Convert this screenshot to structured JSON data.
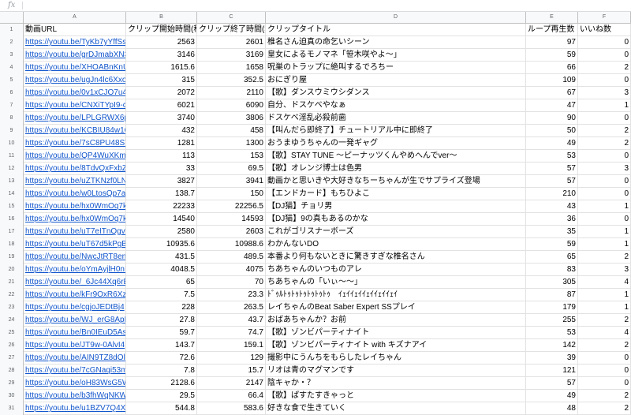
{
  "formula_bar": {
    "fx_label": "fx",
    "value": ""
  },
  "columns": [
    "A",
    "B",
    "C",
    "D",
    "E",
    "F"
  ],
  "header_row": [
    "動画URL",
    "クリップ開始時間(秒)",
    "クリップ終了時間(秒)",
    "クリップタイトル",
    "ループ再生数",
    "いいね数"
  ],
  "rows": [
    [
      "https://youtu.be/TyKb7yYffSs",
      "2563",
      "2601",
      "椎名さん迫真の命乞いシーン",
      "97",
      "0"
    ],
    [
      "https://youtu.be/grDJmabXN3o",
      "3146",
      "3169",
      "皇女によるモノマネ「笹木咲やよ〜」",
      "59",
      "0"
    ],
    [
      "https://youtu.be/XHOABnKnU1s",
      "1615.6",
      "1658",
      "呪巣のトラップに絶叫するでろちー",
      "66",
      "2"
    ],
    [
      "https://youtu.be/ugJn4lc6Xxo",
      "315",
      "352.5",
      "おにぎり屋",
      "109",
      "0"
    ],
    [
      "https://youtu.be/0v1xCJO7u4E",
      "2072",
      "2110",
      "【歌】ダンスウミウシダンス",
      "67",
      "3"
    ],
    [
      "https://youtu.be/CNXiTYpI9-c",
      "6021",
      "6090",
      "自分、ドスケベやなぁ",
      "47",
      "1"
    ],
    [
      "https://youtu.be/LPLGRWX6pm0",
      "3740",
      "3806",
      "ドスケベ淫乱必殺前歯",
      "90",
      "0"
    ],
    [
      "https://youtu.be/KCBIU84w1Q0",
      "432",
      "458",
      "【叫んだら即終了】チュートリアル中に即終了",
      "50",
      "2"
    ],
    [
      "https://youtu.be/7sC8PU48ST8",
      "1281",
      "1300",
      "おうまゆうちゃんの一発ギャグ",
      "49",
      "2"
    ],
    [
      "https://youtu.be/QP4WuXKmUNA",
      "113",
      "153",
      "【歌】STAY TUNE 〜ピーナッツくんやめへんでver〜",
      "53",
      "0"
    ],
    [
      "https://youtu.be/8TdvQxFxbZI",
      "33",
      "69.5",
      "【歌】オレンジ博士は色男",
      "57",
      "3"
    ],
    [
      "https://youtu.be/uZTKNzf0LNc",
      "3827",
      "3941",
      "動画かと思いきや大好きなちーちゃんが生でサプライズ登場",
      "57",
      "0"
    ],
    [
      "https://youtu.be/w0LtosQp7aE",
      "138.7",
      "150",
      "【エンドカード】もちひよこ",
      "210",
      "0"
    ],
    [
      "https://youtu.be/hx0WmOq7kUc",
      "22233",
      "22256.5",
      "【DJ猫】チョリ男",
      "43",
      "1"
    ],
    [
      "https://youtu.be/hx0WmOq7kUc",
      "14540",
      "14593",
      "【DJ猫】9の真もあるのかな",
      "36",
      "0"
    ],
    [
      "https://youtu.be/uT7eITnQgvY",
      "2580",
      "2603",
      "これがゴリスナーボーズ",
      "35",
      "1"
    ],
    [
      "https://youtu.be/uT67d5kPgB8",
      "10935.6",
      "10988.6",
      "わかんないDO",
      "59",
      "1"
    ],
    [
      "https://youtu.be/NwcJtRT8enI",
      "431.5",
      "489.5",
      "本番より何もないときに驚きすぎな椎名さん",
      "65",
      "2"
    ],
    [
      "https://youtu.be/oYmAyjlH0nI",
      "4048.5",
      "4075",
      "ちあちゃんのいつものアレ",
      "83",
      "3"
    ],
    [
      "https://youtu.be/_6Jc44Xq6rE",
      "65",
      "70",
      "ちあちゃんの「いぃ〜〜」",
      "305",
      "4"
    ],
    [
      "https://youtu.be/kFr9OxR6Xzc",
      "7.5",
      "23.3",
      "ﾄﾞｩﾙﾄｩﾄｩﾄｩﾄｩﾄｩﾄｩ　ｲｪｲｲｪｲｲｪｲｲｪｲｲｪｲ",
      "87",
      "1"
    ],
    [
      "https://youtu.be/cgjoJEDtBj4",
      "228",
      "263.5",
      "レイちゃんのBeat Saber Expert SSプレイ",
      "179",
      "1"
    ],
    [
      "https://youtu.be/WJ_erG8ApRw",
      "27.8",
      "43.7",
      "おばあちゃんか？お前",
      "255",
      "2"
    ],
    [
      "https://youtu.be/Bn0IEuD5As4",
      "59.7",
      "74.7",
      "【歌】ゾンビパーティナイト",
      "53",
      "4"
    ],
    [
      "https://youtu.be/JT9w-0AlvI4",
      "143.7",
      "159.1",
      "【歌】ゾンビパーティナイト with キズナアイ",
      "142",
      "2"
    ],
    [
      "https://youtu.be/AIN9TZ8dOlY",
      "72.6",
      "129",
      "撮影中にうんちをもらしたレイちゃん",
      "39",
      "0"
    ],
    [
      "https://youtu.be/7cGNaqi53mE",
      "7.8",
      "15.7",
      "リオは青のマグマンです",
      "121",
      "0"
    ],
    [
      "https://youtu.be/oH83WsG5WCE",
      "2128.6",
      "2147",
      "陰キャか・？",
      "57",
      "0"
    ],
    [
      "https://youtu.be/b3fhWqNKWnA",
      "29.5",
      "66.4",
      "【歌】ぱすたすきゃっと",
      "49",
      "2"
    ],
    [
      "https://youtu.be/u1BZV7Q4Xpk",
      "544.8",
      "583.6",
      "好きな食で生きていく",
      "48",
      "2"
    ]
  ]
}
